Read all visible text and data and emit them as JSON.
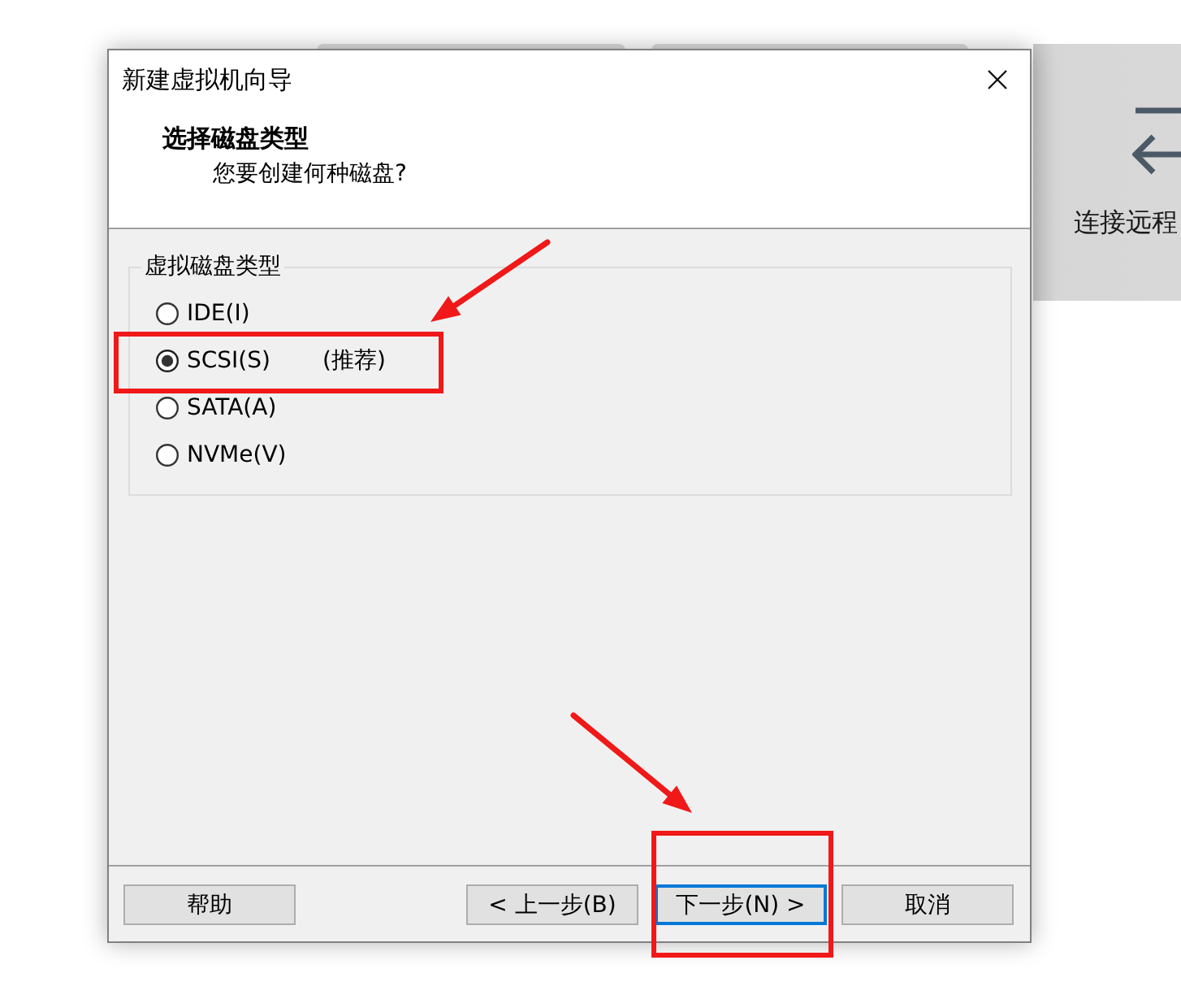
{
  "background_tile": {
    "label": "连接远程"
  },
  "dialog": {
    "title": "新建虚拟机向导",
    "heading": "选择磁盘类型",
    "subheading": "您要创建何种磁盘?",
    "group": {
      "label": "虚拟磁盘类型",
      "options": [
        {
          "label": "IDE(I)",
          "selected": false,
          "highlighted": false
        },
        {
          "label": "SCSI(S)",
          "note": "(推荐)",
          "selected": true,
          "highlighted": true
        },
        {
          "label": "SATA(A)",
          "selected": false,
          "highlighted": false
        },
        {
          "label": "NVMe(V)",
          "selected": false,
          "highlighted": false
        }
      ]
    },
    "buttons": [
      {
        "label": "帮助",
        "focused": false,
        "highlighted": false
      },
      {
        "label": "< 上一步(B)",
        "focused": false,
        "highlighted": false
      },
      {
        "label": "下一步(N) >",
        "focused": true,
        "highlighted": true
      },
      {
        "label": "取消",
        "focused": false,
        "highlighted": false
      }
    ]
  }
}
